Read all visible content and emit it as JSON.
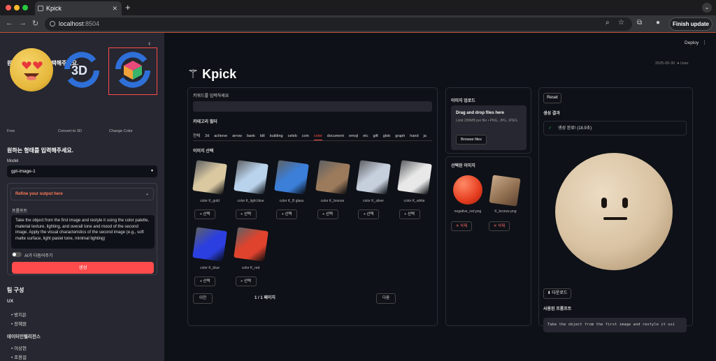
{
  "browser": {
    "tab_title": "Kpick",
    "url_host": "localhost",
    "url_port": ":8504",
    "finish_update": "Finish update"
  },
  "sidebar": {
    "heading1": "원하는 스타일을 선택해주세요.",
    "styles": [
      {
        "label": "Free"
      },
      {
        "label": "Convert to 3D"
      },
      {
        "label": "Change Color"
      }
    ],
    "heading2": "원하는 형태를 입력해주세요.",
    "model_label": "Model",
    "model_value": "gpt-image-1",
    "refine_label": "Refine your output here",
    "prompt_label": "프롬프트",
    "prompt_text": "Take the object from the first image and restyle it using the color palette, material texture, lighting, and overall tone and mood of the second image. Apply the visual characteristics of the second image (e.g., soft matte surface, light pastel tone, minimal lighting)",
    "ai_toggle_label": "AI가 다듬어주기",
    "generate_label": "생성",
    "team_heading": "팀 구성",
    "team_groups": [
      {
        "name": "UX",
        "members": [
          "방지은",
          "장혜원"
        ]
      },
      {
        "name": "데이터인텔리전스",
        "members": [
          "이상현",
          "조용걸"
        ]
      }
    ]
  },
  "header": {
    "deploy": "Deploy",
    "title": "Kpick",
    "date": "2025-05-30",
    "user": "User"
  },
  "left_panel": {
    "keyword_label": "키워드를 입력하세요",
    "keyword_value": "",
    "category_label": "카테고리 필터",
    "categories": [
      "전체",
      "2d",
      "achieve",
      "arrow",
      "bank",
      "bill",
      "building",
      "celeb",
      "coin",
      "color",
      "document",
      "emoji",
      "etc",
      "gift",
      "glob",
      "graph",
      "hand",
      "ja"
    ],
    "active_category": "color",
    "image_select_label": "이미지 선택",
    "images": [
      {
        "caption": "color K_gold",
        "color": "#d9c8a0"
      },
      {
        "caption": "color K_light blue",
        "color": "#b9d3ec"
      },
      {
        "caption": "color K_B glass",
        "color": "#3b7fd9"
      },
      {
        "caption": "color K_bronze",
        "color": "#9c7b5c"
      },
      {
        "caption": "color K_silver",
        "color": "#c6cfdc"
      },
      {
        "caption": "color K_white",
        "color": "#e8e8e8"
      },
      {
        "caption": "color K_blue",
        "color": "#2b3fe0"
      },
      {
        "caption": "color K_red",
        "color": "#e0432d"
      }
    ],
    "select_label": "선택",
    "prev_label": "이전",
    "page_info": "1 / 1 페이지",
    "next_label": "다음"
  },
  "middle_panel": {
    "upload_label": "이미지 업로드",
    "drop_title": "Drag and drop files here",
    "drop_limit": "Limit 200MB per file • PNG, JPG, JPEG",
    "browse_label": "Browse files",
    "selected_label": "선택된 이미지",
    "selected": [
      {
        "caption": "negative_red.png"
      },
      {
        "caption": "K_bronze.png"
      }
    ],
    "delete_label": "삭제"
  },
  "right_panel": {
    "reset_label": "Reset",
    "result_label": "생성 결과",
    "success_text": "생성 완료! (18.9초)",
    "download_label": "다운로드",
    "used_prompt_label": "사용된 프롬프트",
    "used_prompt_text": "Take the object from the first image and restyle it usi"
  }
}
